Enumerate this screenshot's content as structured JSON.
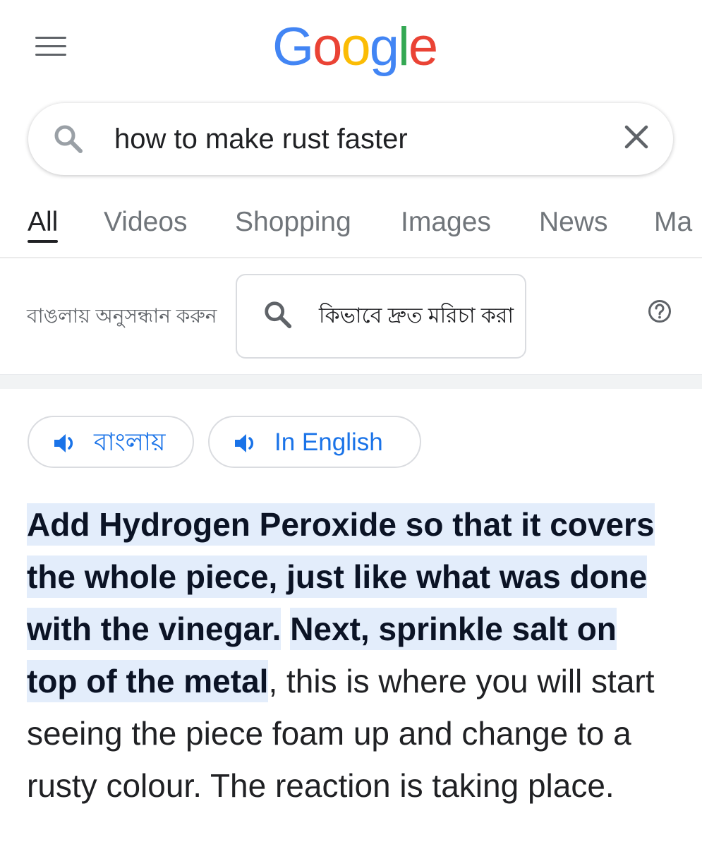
{
  "header": {
    "logo": {
      "letters": [
        {
          "char": "G",
          "color": "#4285F4"
        },
        {
          "char": "o",
          "color": "#EA4335"
        },
        {
          "char": "o",
          "color": "#FBBC05"
        },
        {
          "char": "g",
          "color": "#4285F4"
        },
        {
          "char": "l",
          "color": "#34A853"
        },
        {
          "char": "e",
          "color": "#EA4335"
        }
      ]
    },
    "menu_icon": "hamburger-menu-icon"
  },
  "search": {
    "query": "how to make rust faster",
    "search_icon": "search-icon",
    "clear_icon": "close-icon"
  },
  "tabs": [
    {
      "label": "All",
      "active": true
    },
    {
      "label": "Videos",
      "active": false
    },
    {
      "label": "Shopping",
      "active": false
    },
    {
      "label": "Images",
      "active": false
    },
    {
      "label": "News",
      "active": false
    },
    {
      "label": "Ma",
      "active": false
    }
  ],
  "translate": {
    "label": "বাঙলায় অনুসন্ধান করুন",
    "query": "কিভাবে দ্রুত মরিচা করা",
    "help_icon": "help-circle-icon"
  },
  "listen": {
    "bengali": "বাংলায়",
    "english": "In English",
    "icon": "speaker-icon"
  },
  "answer": {
    "highlight_1": "Add Hydrogen Peroxide so that it covers the whole piece, just like what was done with the vinegar.",
    "highlight_2": "Next, sprinkle salt on top of the metal",
    "rest": ", this is where you will start seeing the piece foam up and change to a rusty colour. The reaction is taking place."
  },
  "colors": {
    "accent": "#1a73e8",
    "highlight_bg": "#e3edfb",
    "muted_text": "#70757a"
  }
}
